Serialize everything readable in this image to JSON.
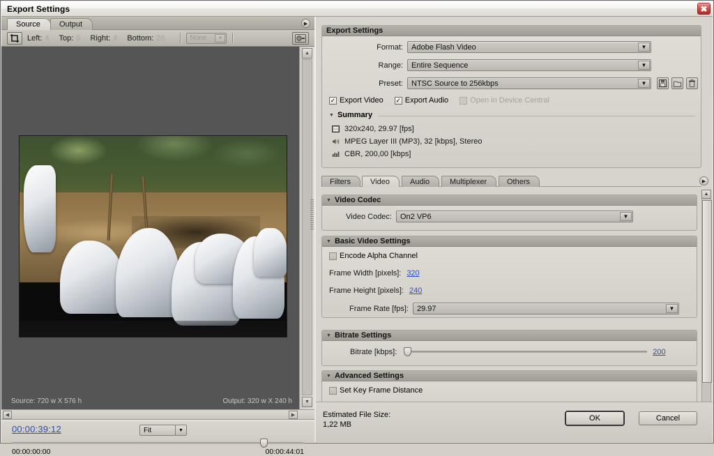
{
  "window": {
    "title": "Export Settings",
    "close_label": "✖"
  },
  "left": {
    "tabs": [
      {
        "label": "Source",
        "active": true
      },
      {
        "label": "Output",
        "active": false
      }
    ],
    "tab_menu_icon": "panel-menu-icon",
    "crop_toolbar": {
      "crop_tool_icon": "crop-tool-icon",
      "left_label": "Left:",
      "left_value": "4",
      "top_label": "Top:",
      "top_value": "0",
      "right_label": "Right:",
      "right_value": "4",
      "bottom_label": "Bottom:",
      "bottom_value": "26",
      "crop_preset": "None",
      "deinterlace_icon": "deinterlace-icon"
    },
    "preview": {
      "source_info": "Source: 720 w X 576 h",
      "output_info": "Output: 320 w X 240 h"
    },
    "playback": {
      "timecode": "00:00:39:12",
      "zoom_level": "Fit",
      "start_time": "00:00:00:00",
      "end_time": "00:00:44:01"
    }
  },
  "right": {
    "export_settings": {
      "title": "Export Settings",
      "format_label": "Format:",
      "format_value": "Adobe Flash Video",
      "range_label": "Range:",
      "range_value": "Entire Sequence",
      "preset_label": "Preset:",
      "preset_value": "NTSC Source to 256kbps",
      "save_preset_icon": "save-preset-icon",
      "import_preset_icon": "import-preset-icon",
      "delete_preset_icon": "delete-preset-icon",
      "export_video_label": "Export Video",
      "export_video_checked": true,
      "export_audio_label": "Export Audio",
      "export_audio_checked": true,
      "device_central_label": "Open in Device Central",
      "device_central_checked": false,
      "summary_title": "Summary",
      "summary": [
        {
          "icon": "video-icon",
          "text": "320x240, 29.97 [fps]"
        },
        {
          "icon": "audio-icon",
          "text": "MPEG Layer III (MP3), 32 [kbps], Stereo"
        },
        {
          "icon": "bitrate-icon",
          "text": "CBR, 200,00 [kbps]"
        }
      ]
    },
    "tabs": [
      {
        "label": "Filters",
        "active": false
      },
      {
        "label": "Video",
        "active": true
      },
      {
        "label": "Audio",
        "active": false
      },
      {
        "label": "Multiplexer",
        "active": false
      },
      {
        "label": "Others",
        "active": false
      }
    ],
    "tabs_menu_icon": "panel-menu-icon",
    "video_codec": {
      "title": "Video Codec",
      "codec_label": "Video Codec:",
      "codec_value": "On2 VP6"
    },
    "basic_video": {
      "title": "Basic Video Settings",
      "alpha_label": "Encode Alpha Channel",
      "alpha_checked": false,
      "frame_width_label": "Frame Width [pixels]:",
      "frame_width_value": "320",
      "frame_height_label": "Frame Height [pixels]:",
      "frame_height_value": "240",
      "frame_rate_label": "Frame Rate [fps]:",
      "frame_rate_value": "29.97"
    },
    "bitrate": {
      "title": "Bitrate Settings",
      "bitrate_label": "Bitrate [kbps]:",
      "bitrate_value": "200"
    },
    "advanced": {
      "title": "Advanced Settings",
      "keyframe_label": "Set Key Frame Distance",
      "keyframe_checked": false
    },
    "footer": {
      "estimated_label": "Estimated File Size:",
      "estimated_value": "1,22 MB",
      "ok_label": "OK",
      "cancel_label": "Cancel"
    }
  }
}
